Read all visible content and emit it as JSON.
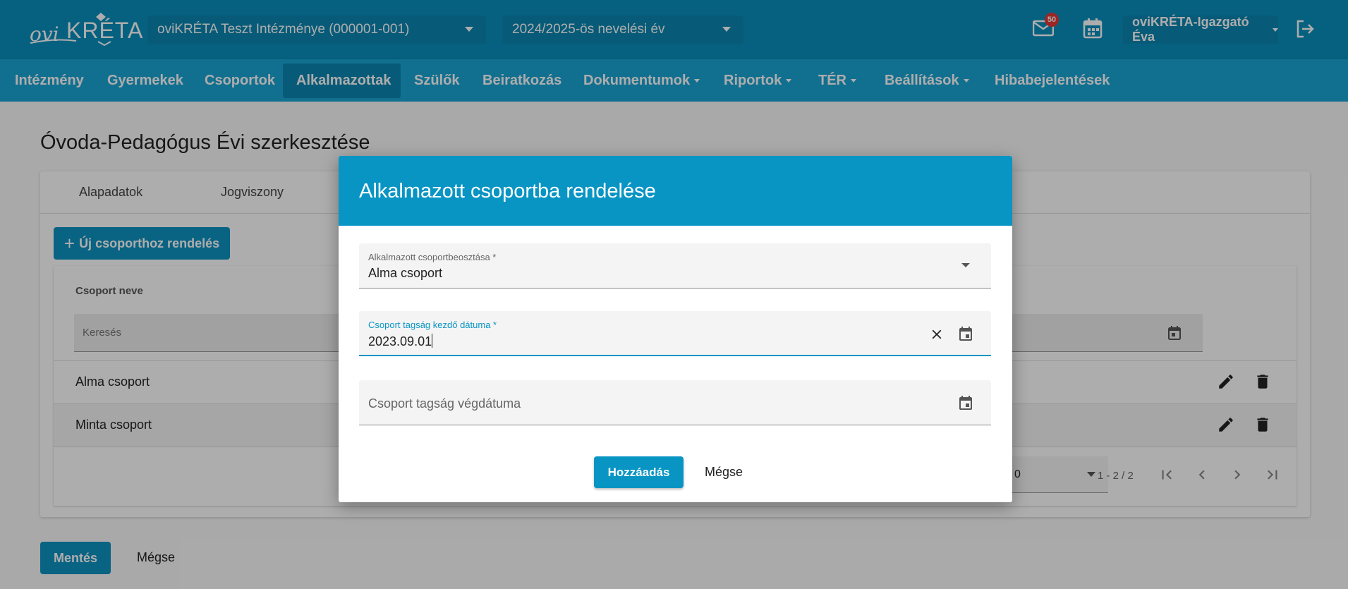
{
  "header": {
    "logo_text_a": "ovi",
    "logo_text_b": "KRÉTA",
    "institution": "oviKRÉTA Teszt Intézménye (000001-001)",
    "year": "2024/2025-ös nevelési év",
    "mail_count": "50",
    "user": "oviKRÉTA-Igazgató Éva"
  },
  "nav": [
    {
      "label": "Intézmény"
    },
    {
      "label": "Gyermekek"
    },
    {
      "label": "Csoportok"
    },
    {
      "label": "Alkalmazottak"
    },
    {
      "label": "Szülők"
    },
    {
      "label": "Beiratkozás"
    },
    {
      "label": "Dokumentumok"
    },
    {
      "label": "Riportok"
    },
    {
      "label": "TÉR"
    },
    {
      "label": "Beállítások"
    },
    {
      "label": "Hibabejelentések"
    }
  ],
  "page": {
    "title": "Óvoda-Pedagógus Évi szerkesztése",
    "tabs": [
      "Alapadatok",
      "Jogviszony"
    ],
    "new_button": "Új csoporthoz rendelés",
    "column_header": "Csoport neve",
    "search_placeholder": "Keresés",
    "rows": [
      "Alma csoport",
      "Minta csoport"
    ],
    "page_size": "0",
    "range": "1 - 2 / 2",
    "save": "Mentés",
    "cancel": "Mégse"
  },
  "modal": {
    "title": "Alkalmazott csoportba rendelése",
    "group_label": "Alkalmazott csoportbeosztása *",
    "group_value": "Alma csoport",
    "start_label": "Csoport tagság kezdő dátuma *",
    "start_value": "2023.09.01",
    "end_placeholder": "Csoport tagság végdátuma",
    "add": "Hozzáadás",
    "cancel": "Mégse"
  },
  "colors": {
    "topbar": "#0990bd",
    "nav": "#1aa6d4",
    "accent": "#0995c4",
    "badge": "#e53935"
  }
}
